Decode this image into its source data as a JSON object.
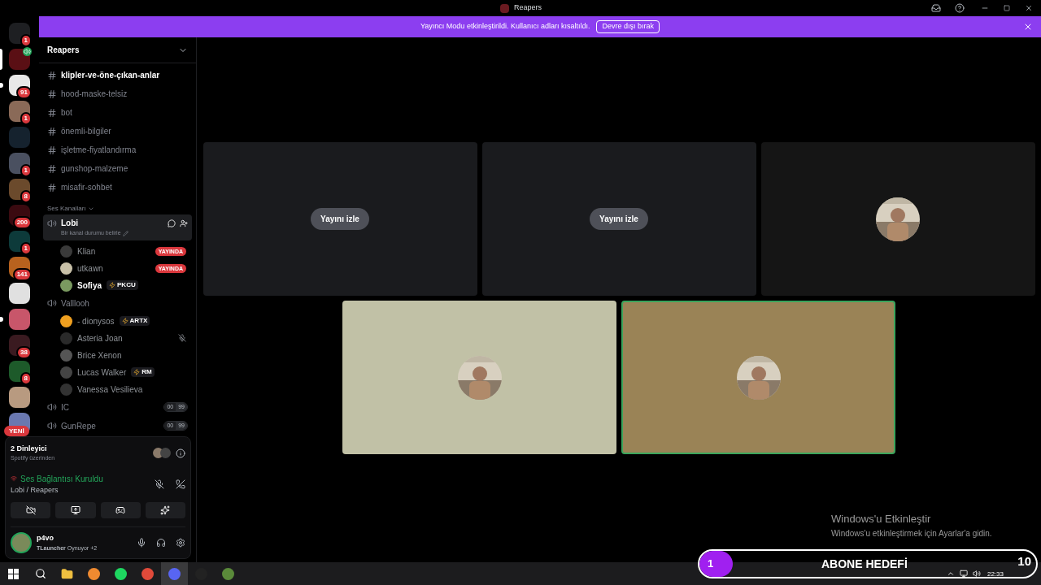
{
  "window": {
    "title": "Reapers"
  },
  "banner": {
    "text": "Yayıncı Modu etkinleştirildi. Kullanıcı adları kısaltıldı.",
    "button": "Devre dışı bırak"
  },
  "servers": [
    {
      "badge": "1",
      "selected": false,
      "unread": false,
      "color": "#1e1f22"
    },
    {
      "selected": true,
      "unread": false,
      "color": "#5a0f14",
      "speaking": true
    },
    {
      "badge": "91",
      "selected": false,
      "unread": true,
      "color": "#e8e8e8"
    },
    {
      "badge": "1",
      "selected": false,
      "unread": false,
      "color": "#8a6a58"
    },
    {
      "selected": false,
      "unread": false,
      "color": "#15222e"
    },
    {
      "badge": "1",
      "selected": false,
      "unread": false,
      "color": "#4a5060"
    },
    {
      "badge": "8",
      "selected": false,
      "unread": false,
      "color": "#6b4a2c"
    },
    {
      "badge": "200",
      "selected": false,
      "unread": false,
      "color": "#3a0a10"
    },
    {
      "badge": "1",
      "selected": false,
      "unread": false,
      "color": "#0d3a3a"
    },
    {
      "badge": "141",
      "selected": false,
      "unread": false,
      "color": "#b8621e"
    },
    {
      "selected": false,
      "unread": false,
      "color": "#e0e0e0"
    },
    {
      "selected": false,
      "unread": true,
      "color": "#c8566a"
    },
    {
      "badge": "38",
      "selected": false,
      "unread": false,
      "color": "#3a1a20"
    },
    {
      "badge": "8",
      "selected": false,
      "unread": false,
      "color": "#1d5a2a"
    },
    {
      "selected": false,
      "unread": false,
      "color": "#b89a80"
    },
    {
      "selected": false,
      "unread": false,
      "color": "#6a78b0",
      "new_label": "YENİ"
    }
  ],
  "server_name": "Reapers",
  "text_channels": [
    {
      "name": "klipler-ve-öne-çıkan-anlar",
      "unread": true
    },
    {
      "name": "hood-maske-telsiz",
      "unread": false
    },
    {
      "name": "bot",
      "unread": false
    },
    {
      "name": "önemli-bilgiler",
      "unread": false
    },
    {
      "name": "işletme-fiyatlandırma",
      "unread": false
    },
    {
      "name": "gunshop-malzeme",
      "unread": false
    },
    {
      "name": "misafir-sohbet",
      "unread": false
    }
  ],
  "voice_category": "Ses Kanalları",
  "voice_channels": [
    {
      "name": "Lobi",
      "selected": true,
      "status": "Bir kanal durumu belirle",
      "members": [
        {
          "name": "Klian",
          "live": "YAYINDA",
          "bold": false,
          "color": "#3a3a3a"
        },
        {
          "name": "utkawn",
          "live": "YAYINDA",
          "bold": false,
          "color": "#c8c0a8"
        },
        {
          "name": "Sofiya",
          "tag": "PKCU",
          "bold": true,
          "color": "#7a9a60"
        }
      ]
    },
    {
      "name": "Valllooh",
      "selected": false,
      "members": [
        {
          "name": "- dionysos",
          "tag": "ARTX",
          "bold": false,
          "color": "#f0a020"
        },
        {
          "name": "Asteria Joan",
          "bold": false,
          "color": "#2a2a2a",
          "muted": true
        },
        {
          "name": "Brice Xenon",
          "bold": false,
          "color": "#555555"
        },
        {
          "name": "Lucas Walker",
          "tag": "RM",
          "bold": false,
          "color": "#444444"
        },
        {
          "name": "Vanessa Vesilieva",
          "bold": false,
          "color": "#333333"
        }
      ]
    },
    {
      "name": "IC",
      "selected": false,
      "counts": [
        "00",
        "99"
      ]
    },
    {
      "name": "GunRepe",
      "selected": false,
      "counts": [
        "00",
        "99"
      ]
    }
  ],
  "activity": {
    "title": "2 Dinleyici",
    "subtitle": "Spotify üzerinden"
  },
  "voice_status": {
    "title": "Ses Bağlantısı Kuruldu",
    "channel": "Lobi / Reapers"
  },
  "user": {
    "name": "p4vo",
    "activity": "**TLauncher** Oynuyor +2"
  },
  "tiles": [
    {
      "kind": "stream",
      "button": "Yayını izle",
      "speaking": false
    },
    {
      "kind": "stream",
      "button": "Yayını izle",
      "speaking": false
    },
    {
      "kind": "avatar",
      "color": "#151515",
      "speaking": false
    },
    {
      "kind": "avatar",
      "color": "#c1c1a6",
      "speaking": false
    },
    {
      "kind": "avatar",
      "color": "#9a8356",
      "speaking": true
    }
  ],
  "activation": {
    "title": "Windows'u Etkinleştir",
    "text": "Windows'u etkinleştirmek için Ayarlar'a gidin."
  },
  "goal": {
    "current": "1",
    "label": "ABONE HEDEFİ",
    "target": "10",
    "level": 0.1
  },
  "clock": "22:33"
}
